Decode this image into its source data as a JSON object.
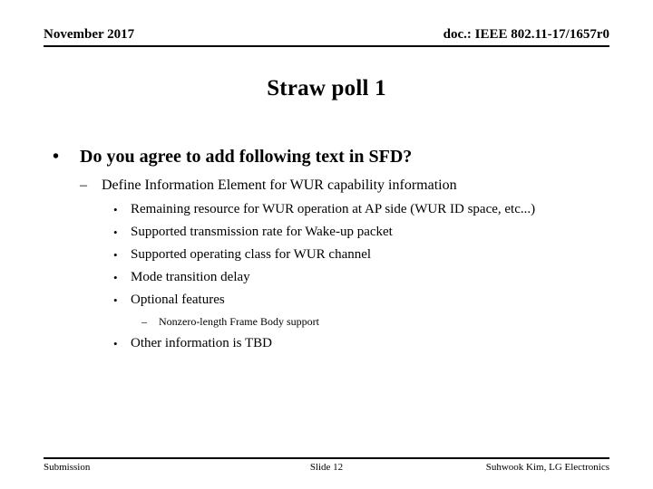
{
  "header": {
    "date": "November 2017",
    "doc": "doc.: IEEE 802.11-17/1657r0"
  },
  "title": "Straw poll 1",
  "bullets": {
    "level1": {
      "marker": "•",
      "text": "Do you agree to add following text in SFD?"
    },
    "level2": {
      "marker": "–",
      "text": "Define Information Element for WUR capability information"
    },
    "level3": [
      {
        "marker": "•",
        "text": "Remaining resource for WUR operation at AP side (WUR ID space, etc...)"
      },
      {
        "marker": "•",
        "text": "Supported transmission rate for Wake-up packet"
      },
      {
        "marker": "•",
        "text": "Supported operating class for WUR channel"
      },
      {
        "marker": "•",
        "text": "Mode transition delay"
      },
      {
        "marker": "•",
        "text": "Optional features"
      }
    ],
    "level4": {
      "marker": "–",
      "text": "Nonzero-length Frame Body support"
    },
    "level3_last": {
      "marker": "•",
      "text": "Other information is TBD"
    }
  },
  "footer": {
    "left": "Submission",
    "center": "Slide 12",
    "right": "Suhwook Kim, LG Electronics"
  },
  "colors": {
    "text": "#000000",
    "background": "#ffffff",
    "rule": "#000000"
  }
}
